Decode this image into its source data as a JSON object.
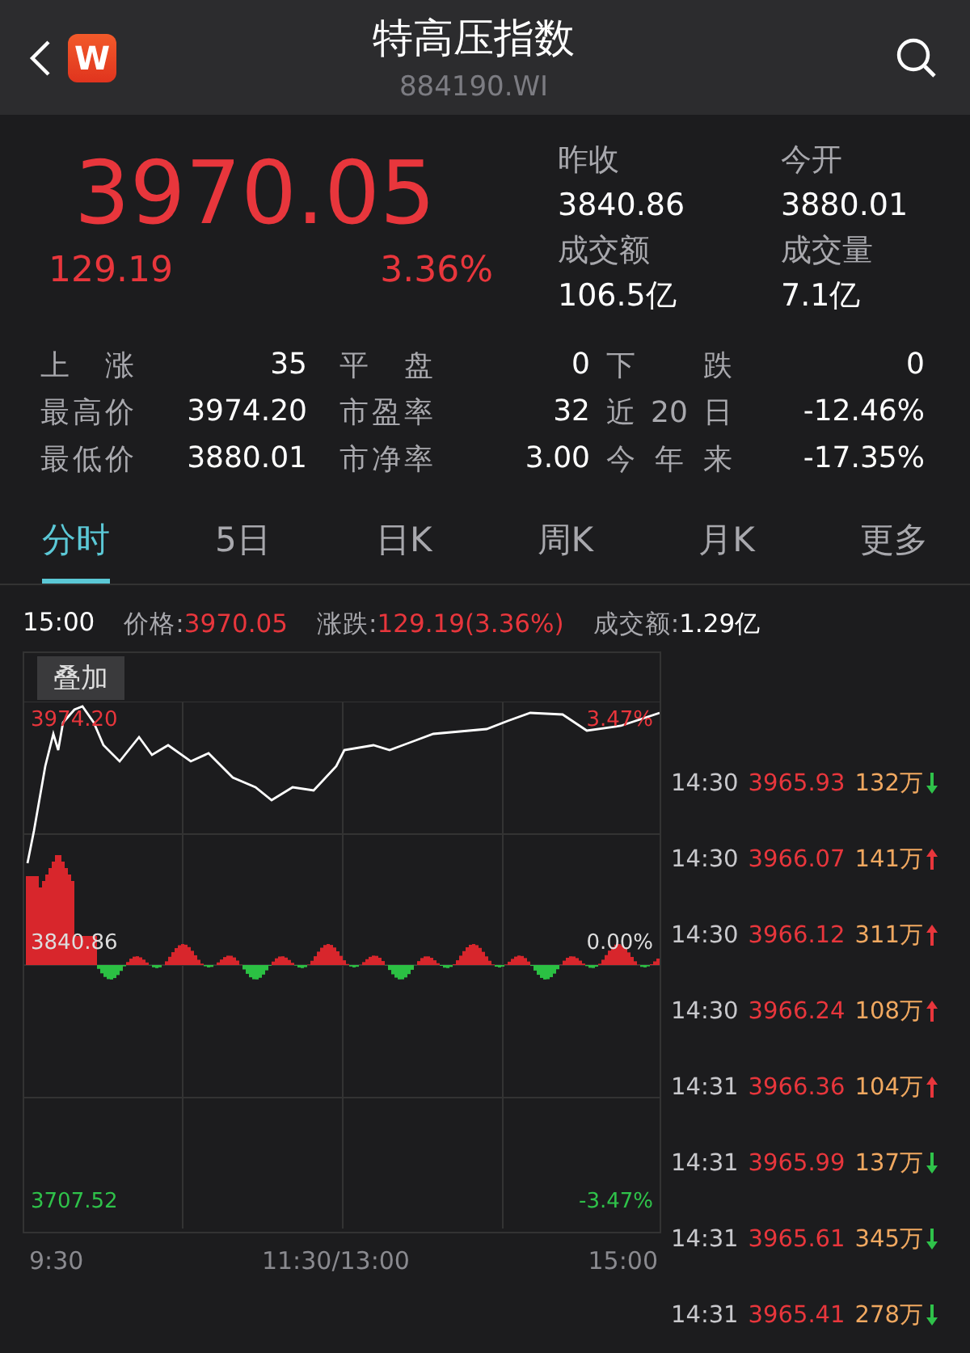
{
  "header": {
    "title": "特高压指数",
    "code": "884190.WI",
    "app_badge": "W"
  },
  "quote": {
    "price": "3970.05",
    "change": "129.19",
    "change_pct": "3.36%",
    "fields": [
      {
        "label": "昨收",
        "value": "3840.86"
      },
      {
        "label": "今开",
        "value": "3880.01"
      },
      {
        "label": "成交额",
        "value": "106.5亿"
      },
      {
        "label": "成交量",
        "value": "7.1亿"
      }
    ]
  },
  "stats": [
    [
      {
        "label": "上涨",
        "value": "35"
      },
      {
        "label": "平盘",
        "value": "0"
      },
      {
        "label": "下跌",
        "value": "0"
      }
    ],
    [
      {
        "label": "最高价",
        "value": "3974.20"
      },
      {
        "label": "市盈率",
        "value": "32"
      },
      {
        "label": "近20日",
        "value": "-12.46%"
      }
    ],
    [
      {
        "label": "最低价",
        "value": "3880.01"
      },
      {
        "label": "市净率",
        "value": "3.00"
      },
      {
        "label": "今年来",
        "value": "-17.35%"
      }
    ]
  ],
  "tabs": [
    {
      "label": "分时",
      "selected": true
    },
    {
      "label": "5日",
      "selected": false
    },
    {
      "label": "日K",
      "selected": false
    },
    {
      "label": "周K",
      "selected": false
    },
    {
      "label": "月K",
      "selected": false
    },
    {
      "label": "更多",
      "selected": false
    }
  ],
  "info_bar": {
    "time": "15:00",
    "price_label": "价格:",
    "price": "3970.05",
    "change_label": "涨跌:",
    "change": "129.19(3.36%)",
    "amount_label": "成交额:",
    "amount": "1.29亿"
  },
  "chart": {
    "overlay_button": "叠加",
    "high": "3974.20",
    "high_pct": "3.47%",
    "base": "3840.86",
    "base_pct": "0.00%",
    "low": "3707.52",
    "low_pct": "-3.47%",
    "x_labels": [
      "9:30",
      "11:30/13:00",
      "15:00"
    ]
  },
  "trades": [
    {
      "time": "14:30",
      "price": "3965.93",
      "volume": "132万",
      "rising": false
    },
    {
      "time": "14:30",
      "price": "3966.07",
      "volume": "141万",
      "rising": true
    },
    {
      "time": "14:30",
      "price": "3966.12",
      "volume": "311万",
      "rising": true
    },
    {
      "time": "14:30",
      "price": "3966.24",
      "volume": "108万",
      "rising": true
    },
    {
      "time": "14:31",
      "price": "3966.36",
      "volume": "104万",
      "rising": true
    },
    {
      "time": "14:31",
      "price": "3965.99",
      "volume": "137万",
      "rising": false
    },
    {
      "time": "14:31",
      "price": "3965.61",
      "volume": "345万",
      "rising": false
    },
    {
      "time": "14:31",
      "price": "3965.41",
      "volume": "278万",
      "rising": false
    }
  ]
}
